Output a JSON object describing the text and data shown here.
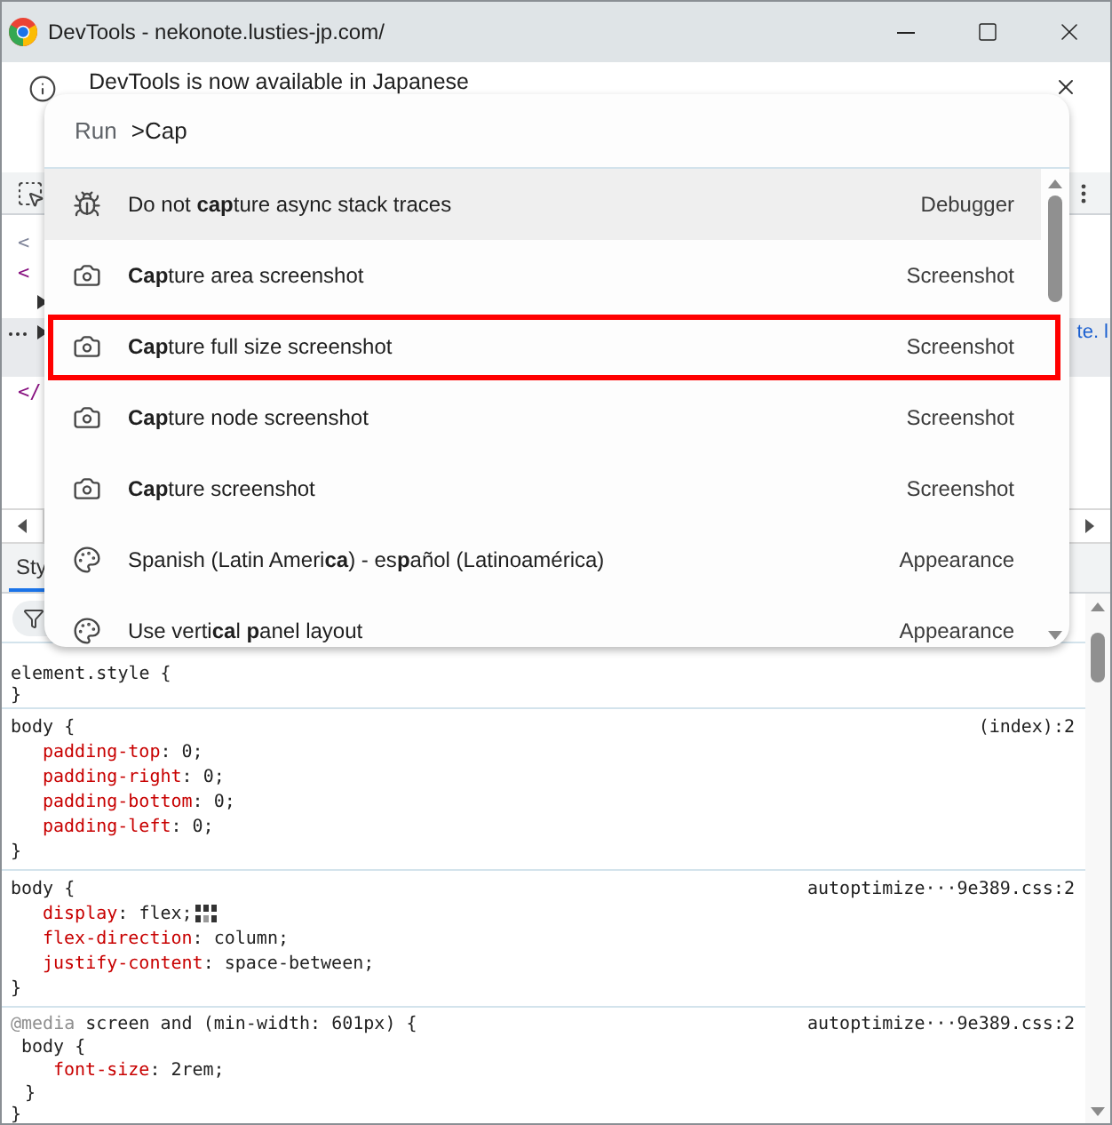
{
  "window": {
    "title": "DevTools - nekonote.lusties-jp.com/"
  },
  "infobar": {
    "message": "DevTools is now available in Japanese"
  },
  "elements_tree": [
    {
      "kind": "doctype",
      "text": "<",
      "selected": false
    },
    {
      "kind": "tag",
      "text": "<",
      "selected": false
    },
    {
      "kind": "node",
      "expanded": false,
      "selected": false
    },
    {
      "kind": "node",
      "expanded": false,
      "selected": true,
      "trailing": "te. l"
    },
    {
      "kind": "tag",
      "text": "</",
      "selected": false
    }
  ],
  "styles_tabs": [
    {
      "label": "Sty",
      "selected": true
    }
  ],
  "styles": {
    "rules": [
      {
        "kind": "rule",
        "selector": "element.style {",
        "close": "}"
      },
      {
        "kind": "rule",
        "selector": "body {",
        "source": "(index):2",
        "declarations": [
          {
            "property": "padding-top",
            "value": ": 0;",
            "grid_badge": false
          },
          {
            "property": "padding-right",
            "value": ": 0;",
            "grid_badge": false
          },
          {
            "property": "padding-bottom",
            "value": ": 0;",
            "grid_badge": false
          },
          {
            "property": "padding-left",
            "value": ": 0;",
            "grid_badge": false
          }
        ],
        "close": "}"
      },
      {
        "kind": "rule",
        "selector": "body {",
        "source": "autoptimize···9e389.css:2",
        "declarations": [
          {
            "property": "display",
            "value": ": flex;",
            "grid_badge": true
          },
          {
            "property": "flex-direction",
            "value": ": column;",
            "grid_badge": false
          },
          {
            "property": "justify-content",
            "value": ": space-between;",
            "grid_badge": false
          }
        ],
        "close": "}"
      },
      {
        "kind": "media",
        "at_rule": "@media",
        "condition": "screen and (min-width: 601px) {",
        "source": "autoptimize···9e389.css:2",
        "selector": "body {",
        "declarations": [
          {
            "property": "font-size",
            "value": ": 2rem;",
            "grid_badge": false
          }
        ],
        "inner_close": "}",
        "close": "}"
      }
    ]
  },
  "command_menu": {
    "prefix": "Run",
    "query": ">Cap",
    "items": [
      {
        "kind": "debugger",
        "label": "Do not **cap**ture async stack traces",
        "category": "Debugger",
        "selected": true,
        "annotated": false
      },
      {
        "kind": "screenshot",
        "label": "**Cap**ture area screenshot",
        "category": "Screenshot",
        "selected": false,
        "annotated": false
      },
      {
        "kind": "screenshot",
        "label": "**Cap**ture full size screenshot",
        "category": "Screenshot",
        "selected": false,
        "annotated": true
      },
      {
        "kind": "screenshot",
        "label": "**Cap**ture node screenshot",
        "category": "Screenshot",
        "selected": false,
        "annotated": false
      },
      {
        "kind": "screenshot",
        "label": "**Cap**ture screenshot",
        "category": "Screenshot",
        "selected": false,
        "annotated": false
      },
      {
        "kind": "appearance",
        "label": "Spanish (Latin Ameri**ca**) - es**p**añol (Latinoamérica)",
        "category": "Appearance",
        "selected": false,
        "annotated": false
      },
      {
        "kind": "appearance",
        "label": "Use verti**ca**l **p**anel layout",
        "category": "Appearance",
        "selected": false,
        "annotated": false
      }
    ]
  }
}
